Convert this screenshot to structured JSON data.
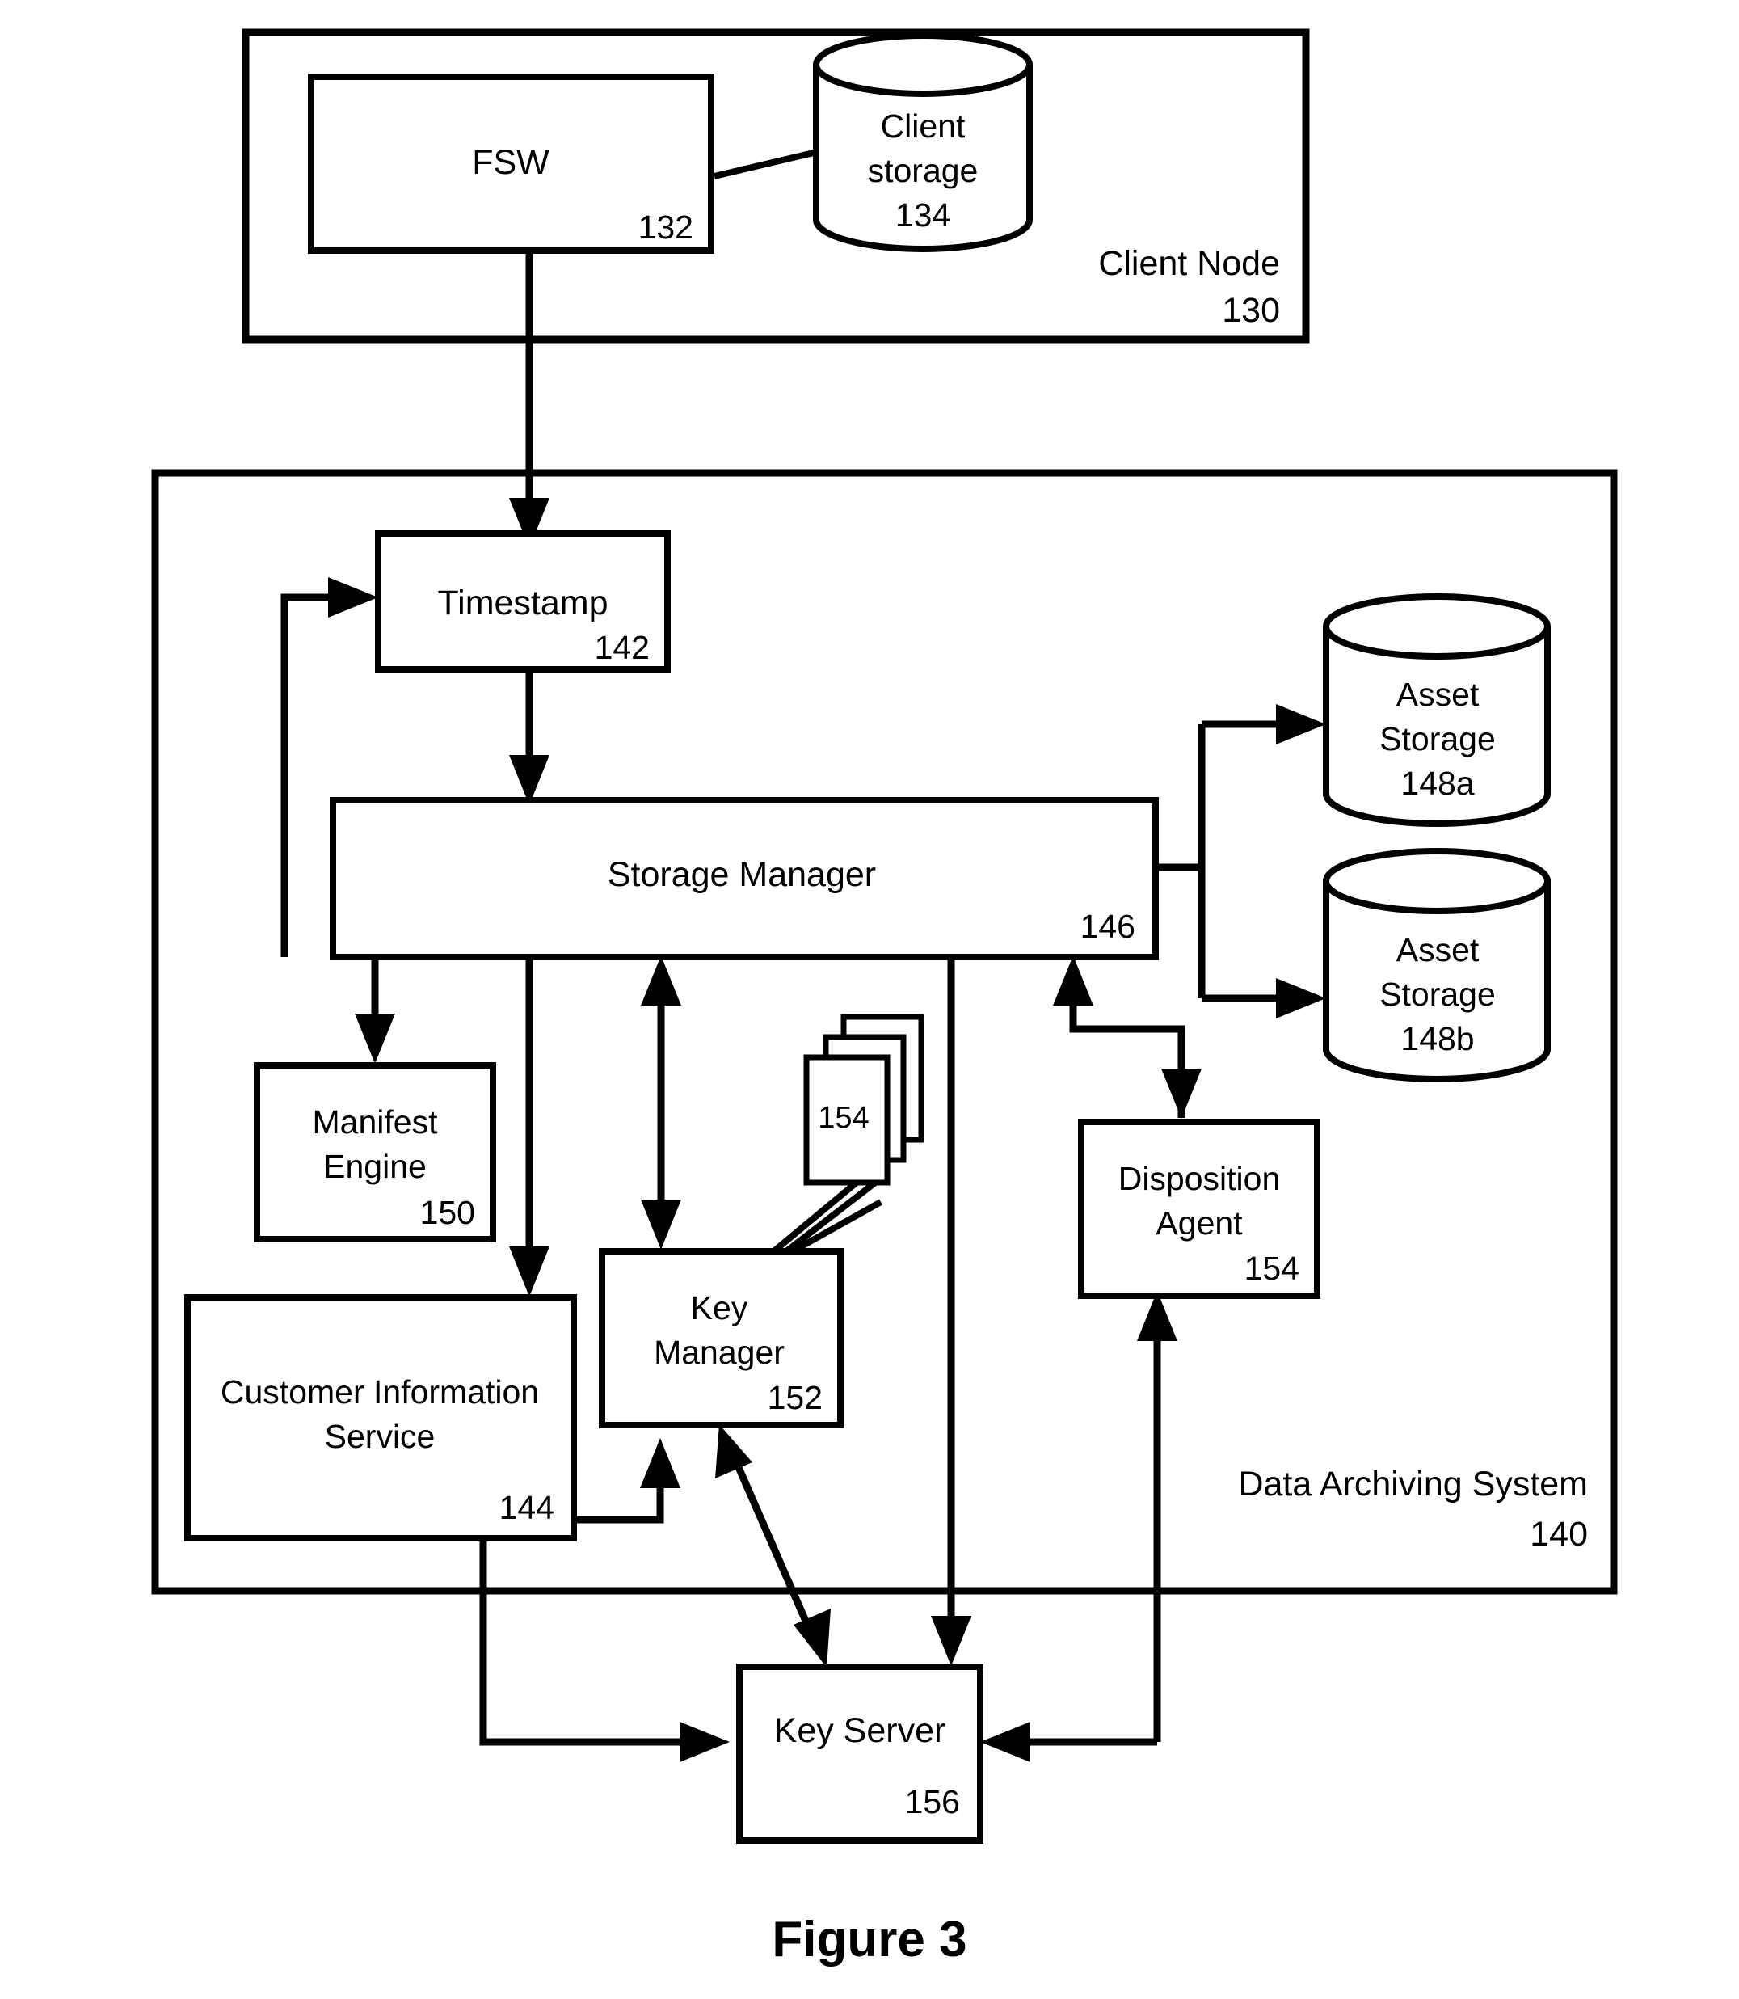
{
  "figure": {
    "caption": "Figure 3"
  },
  "containers": [
    {
      "id": "client-node",
      "label": "Client Node",
      "ref": "130"
    },
    {
      "id": "data-archiving-system",
      "label": "Data Archiving System",
      "ref": "140"
    }
  ],
  "nodes": {
    "fsw": {
      "label": "FSW",
      "ref": "132"
    },
    "client_storage": {
      "label_line1": "Client",
      "label_line2": "storage",
      "ref": "134"
    },
    "timestamp": {
      "label": "Timestamp",
      "ref": "142"
    },
    "storage_manager": {
      "label": "Storage Manager",
      "ref": "146"
    },
    "asset_storage_a": {
      "label_line1": "Asset",
      "label_line2": "Storage",
      "ref": "148a"
    },
    "asset_storage_b": {
      "label_line1": "Asset",
      "label_line2": "Storage",
      "ref": "148b"
    },
    "manifest_engine": {
      "label_line1": "Manifest",
      "label_line2": "Engine",
      "ref": "150"
    },
    "customer_information_service": {
      "label_line1": "Customer Information",
      "label_line2": "Service",
      "ref": "144"
    },
    "key_manager": {
      "label_line1": "Key",
      "label_line2": "Manager",
      "ref": "152"
    },
    "policy_documents": {
      "ref": "154"
    },
    "disposition_agent": {
      "label_line1": "Disposition",
      "label_line2": "Agent",
      "ref": "154"
    },
    "key_server": {
      "label": "Key Server",
      "ref": "156"
    }
  },
  "colors": {
    "stroke": "#000000",
    "fill": "#ffffff",
    "text": "#000000"
  }
}
